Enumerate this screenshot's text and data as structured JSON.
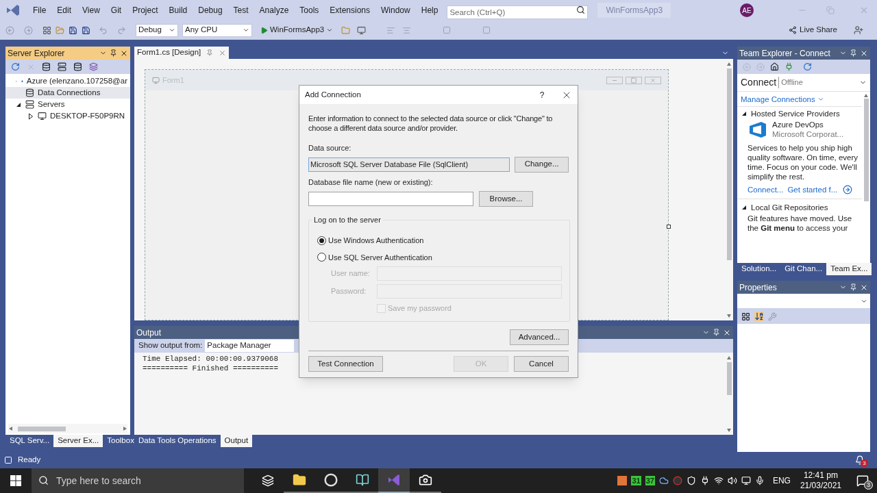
{
  "window": {
    "title": "WinFormsApp3",
    "menu": [
      "File",
      "Edit",
      "View",
      "Git",
      "Project",
      "Build",
      "Debug",
      "Test",
      "Analyze",
      "Tools",
      "Extensions",
      "Window",
      "Help"
    ],
    "search": {
      "placeholder": "Search (Ctrl+Q)"
    },
    "avatar": "AE"
  },
  "toolbar": {
    "configuration": "Debug",
    "platform": "Any CPU",
    "start": "WinFormsApp3",
    "live_share": "Live Share"
  },
  "server_explorer": {
    "title": "Server Explorer",
    "tree": [
      {
        "label": "Azure (elenzano.107258@ar",
        "kind": "azure",
        "expanded": false,
        "selected": false
      },
      {
        "label": "Data Connections",
        "kind": "data",
        "selected": true
      },
      {
        "label": "Servers",
        "kind": "servers",
        "expanded": true,
        "selected": false,
        "children": [
          {
            "label": "DESKTOP-F50P9RN",
            "kind": "server",
            "expanded": false,
            "selected": false
          }
        ]
      }
    ],
    "tabs": [
      {
        "label": "SQL Serv...",
        "selected": false
      },
      {
        "label": "Server Ex...",
        "selected": true
      },
      {
        "label": "Toolbox",
        "selected": false
      }
    ]
  },
  "document": {
    "tab": "Form1.cs [Design]",
    "form_title": "Form1"
  },
  "output": {
    "title": "Output",
    "source_label": "Show output from:",
    "source": "Package Manager",
    "lines": [
      "Time Elapsed: 00:00:00.9379068",
      "========== Finished =========="
    ],
    "tabs": [
      {
        "label": "Data Tools Operations",
        "selected": false
      },
      {
        "label": "Output",
        "selected": true
      }
    ]
  },
  "team_explorer": {
    "title": "Team Explorer - Connect",
    "page": "Connect",
    "status": "Offline",
    "manage": "Manage Connections",
    "sections": [
      {
        "title": "Hosted Service Providers",
        "expanded": true,
        "provider": {
          "name": "Azure DevOps",
          "publisher": "Microsoft Corporat...",
          "description": "Services to help you ship high quality software. On time, every time. Focus on your code. We'll simplify the rest.",
          "links": [
            "Connect...",
            "Get started f..."
          ]
        }
      },
      {
        "title": "Local Git Repositories",
        "expanded": true,
        "text": "Git features have moved. Use the **Git menu** to access your"
      }
    ],
    "tabs": [
      {
        "label": "Solution...",
        "selected": false
      },
      {
        "label": "Git Chan...",
        "selected": false
      },
      {
        "label": "Team Ex...",
        "selected": true
      }
    ]
  },
  "properties": {
    "title": "Properties"
  },
  "dialog": {
    "title": "Add Connection",
    "help": "?",
    "intro": "Enter information to connect to the selected data source or click \"Change\" to choose a different data source and/or provider.",
    "data_source_label": "Data source:",
    "data_source": "Microsoft SQL Server Database File (SqlClient)",
    "change": "Change...",
    "file_label": "Database file name (new or existing):",
    "browse": "Browse...",
    "logon": {
      "title": "Log on to the server",
      "options": [
        {
          "label": "Use Windows Authentication",
          "selected": true
        },
        {
          "label": "Use SQL Server Authentication",
          "selected": false
        }
      ],
      "fields_disabled": true,
      "user_label": "User name:",
      "password_label": "Password:",
      "save_password": {
        "label": "Save my password",
        "checked": false
      }
    },
    "advanced": "Advanced...",
    "test": "Test Connection",
    "ok": {
      "label": "OK",
      "disabled": true
    },
    "cancel": "Cancel"
  },
  "status_bar": {
    "text": "Ready",
    "notifications": "3"
  },
  "taskbar": {
    "search_placeholder": "Type here to search",
    "apps": [
      {
        "kind": "taskview",
        "selected": false
      },
      {
        "kind": "folder",
        "selected": false
      },
      {
        "kind": "browser",
        "selected": false
      },
      {
        "kind": "notebook",
        "selected": false
      },
      {
        "kind": "studio",
        "selected": true
      },
      {
        "kind": "recorder",
        "selected": false
      }
    ],
    "tray": [
      "31",
      "37"
    ],
    "language": "ENG",
    "time": "12:41 pm",
    "date": "21/03/2021",
    "notifications": "3"
  }
}
